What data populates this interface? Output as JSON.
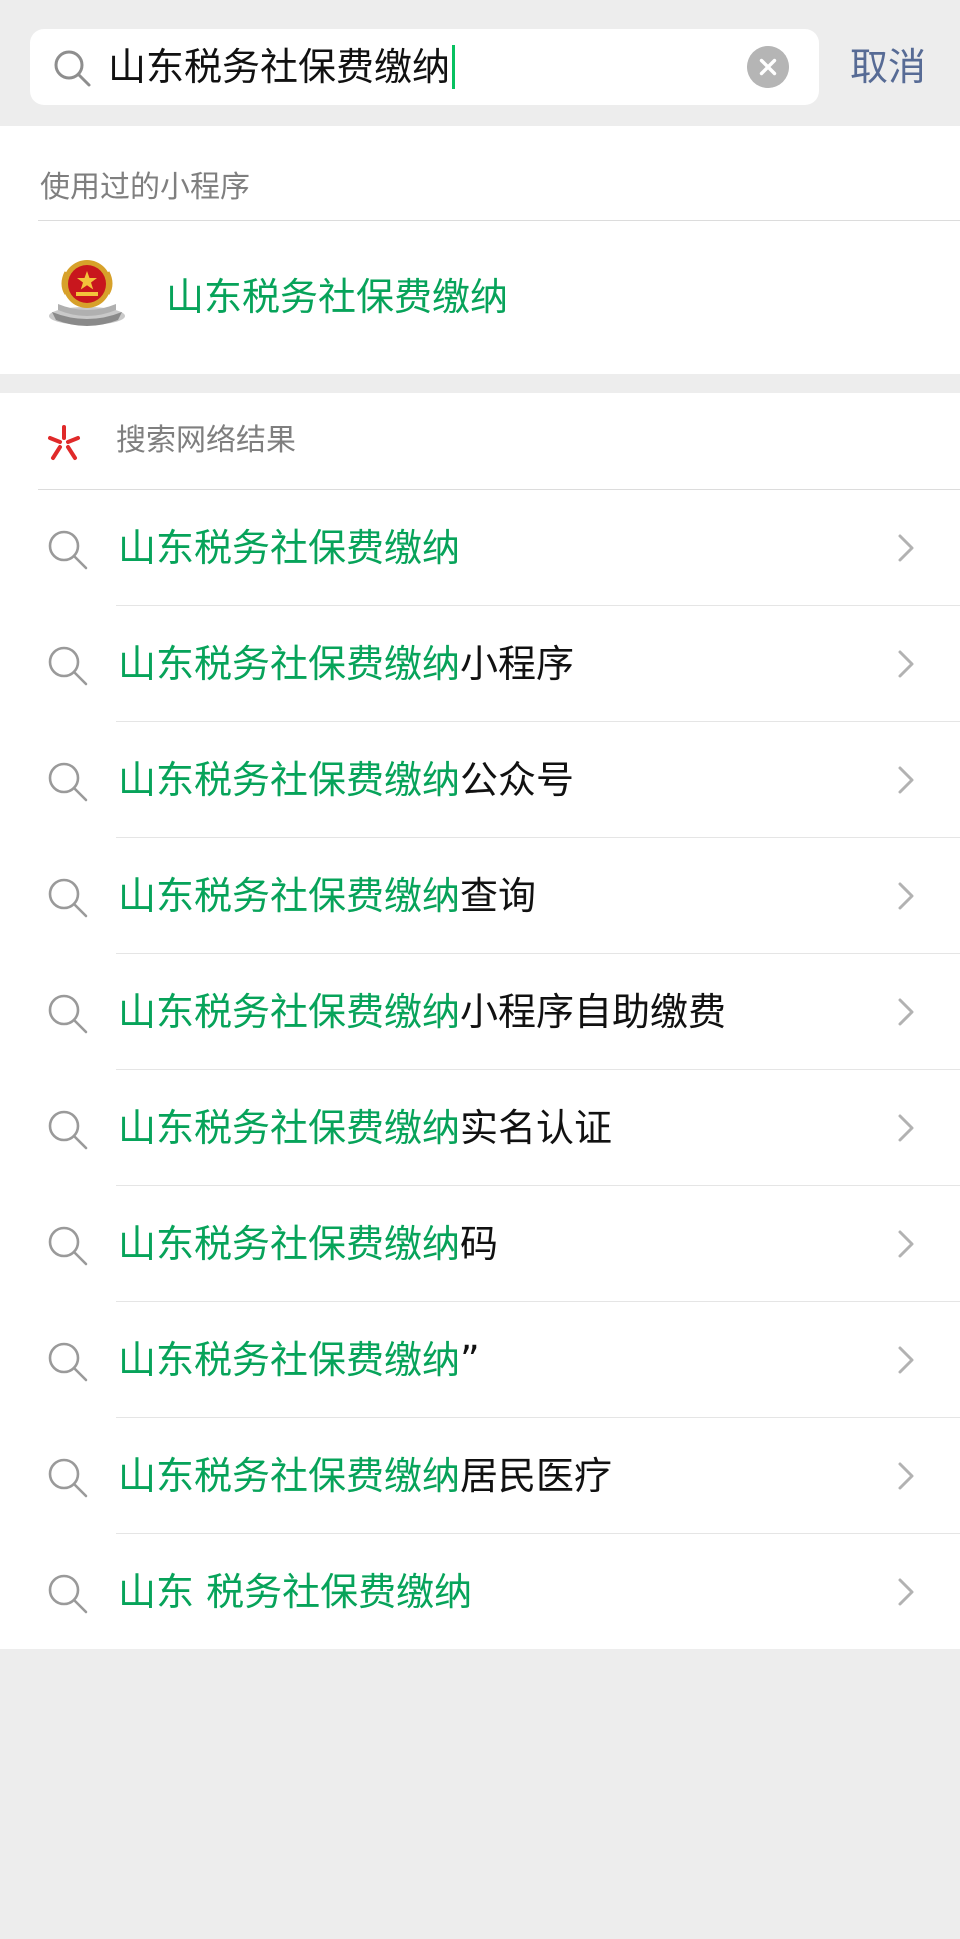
{
  "search": {
    "value": "山东税务社保费缴纳",
    "cancel_label": "取消"
  },
  "used_miniprograms": {
    "title": "使用过的小程序",
    "items": [
      {
        "name": "山东税务社保费缴纳",
        "icon": "tax-emblem-icon"
      }
    ]
  },
  "web_results": {
    "title": "搜索网络结果",
    "suggestions": [
      {
        "highlight": "山东税务社保费缴纳",
        "rest": ""
      },
      {
        "highlight": "山东税务社保费缴纳",
        "rest": "小程序"
      },
      {
        "highlight": "山东税务社保费缴纳",
        "rest": "公众号"
      },
      {
        "highlight": "山东税务社保费缴纳",
        "rest": "查询"
      },
      {
        "highlight": "山东税务社保费缴纳",
        "rest": "小程序自助缴费"
      },
      {
        "highlight": "山东税务社保费缴纳",
        "rest": "实名认证"
      },
      {
        "highlight": "山东税务社保费缴纳",
        "rest": "码"
      },
      {
        "highlight": "山东税务社保费缴纳",
        "rest": "”"
      },
      {
        "highlight": "山东税务社保费缴纳",
        "rest": "居民医疗"
      },
      {
        "highlight": "山东 税务社保费缴纳",
        "rest": ""
      }
    ]
  },
  "colors": {
    "accent_green": "#07a35a",
    "cancel_blue": "#576b95",
    "background": "#ededed"
  }
}
